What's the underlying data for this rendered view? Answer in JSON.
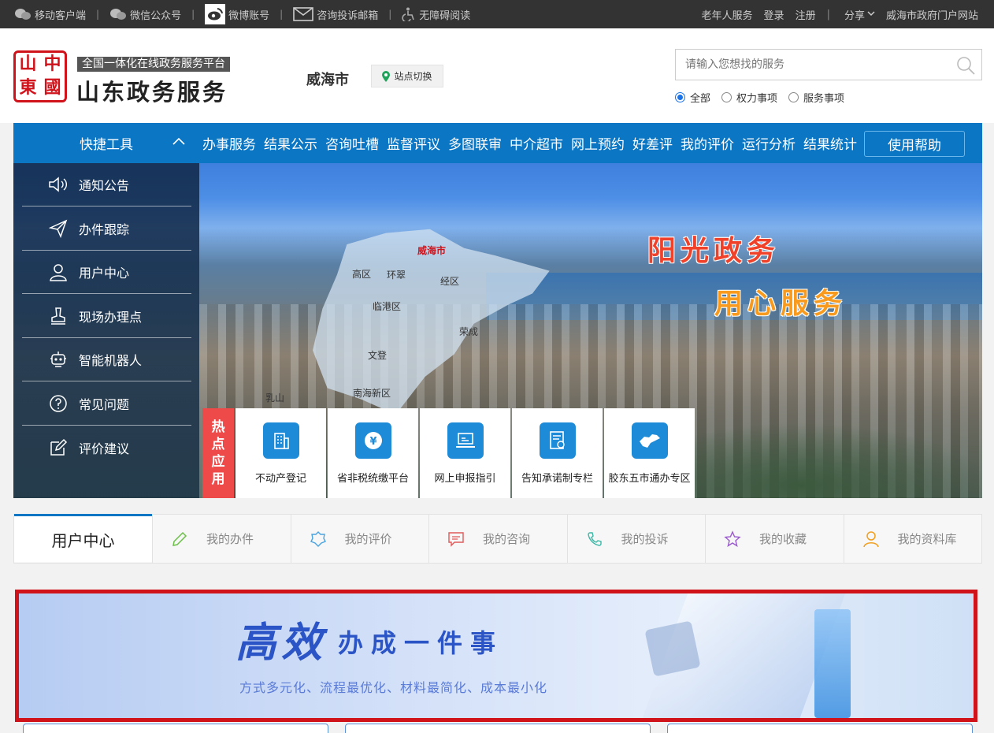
{
  "topbar": {
    "left": [
      {
        "label": "移动客户端",
        "icon": "wechat-like-icon"
      },
      {
        "label": "微信公众号",
        "icon": "wechat-icon"
      },
      {
        "label": "微博账号",
        "icon": "weibo-icon"
      },
      {
        "label": "咨询投诉邮箱",
        "icon": "mail-icon"
      },
      {
        "label": "无障碍阅读",
        "icon": "accessibility-icon"
      }
    ],
    "right": {
      "elderly": "老年人服务",
      "login": "登录",
      "register": "注册",
      "share": "分享",
      "portal": "威海市政府门户网站"
    }
  },
  "header": {
    "seal_chars": [
      "中",
      "國",
      "山",
      "東"
    ],
    "tagline": "全国一体化在线政务服务平台",
    "title": "山东政务服务",
    "city": "威海市",
    "switch_label": "站点切换",
    "search_placeholder": "请输入您想找的服务",
    "radios": [
      {
        "label": "全部",
        "checked": true
      },
      {
        "label": "权力事项",
        "checked": false
      },
      {
        "label": "服务事项",
        "checked": false
      }
    ]
  },
  "nav": {
    "quick_tools": "快捷工具",
    "items": [
      "办事服务",
      "结果公示",
      "咨询吐槽",
      "监督评议",
      "多图联审",
      "中介超市",
      "网上预约",
      "好差评",
      "我的评价",
      "运行分析",
      "结果统计"
    ],
    "help": "使用帮助"
  },
  "sidebar": {
    "items": [
      {
        "label": "通知公告",
        "icon": "speaker-icon"
      },
      {
        "label": "办件跟踪",
        "icon": "paper-plane-icon"
      },
      {
        "label": "用户中心",
        "icon": "user-icon"
      },
      {
        "label": "现场办理点",
        "icon": "stamp-icon"
      },
      {
        "label": "智能机器人",
        "icon": "robot-icon"
      },
      {
        "label": "常见问题",
        "icon": "question-icon"
      },
      {
        "label": "评价建议",
        "icon": "edit-icon"
      }
    ]
  },
  "hero": {
    "map_labels": [
      "威海市",
      "高区",
      "环翠",
      "经区",
      "临港区",
      "荣成",
      "文登",
      "乳山",
      "南海新区"
    ],
    "slogan1": "阳光政务",
    "slogan2": "用心服务",
    "hot_tag": [
      "热",
      "点",
      "应",
      "用"
    ],
    "hot_apps": [
      "不动产登记",
      "省非税统缴平台",
      "网上申报指引",
      "告知承诺制专栏",
      "胶东五市通办专区"
    ]
  },
  "user_center": {
    "title": "用户中心",
    "tabs": [
      {
        "label": "我的办件",
        "icon": "pencil-icon",
        "color": "#6cc04a"
      },
      {
        "label": "我的评价",
        "icon": "badge-icon",
        "color": "#4aa3df"
      },
      {
        "label": "我的咨询",
        "icon": "chat-icon",
        "color": "#e05a5a"
      },
      {
        "label": "我的投诉",
        "icon": "phone-icon",
        "color": "#3cb7a6"
      },
      {
        "label": "我的收藏",
        "icon": "star-icon",
        "color": "#9b59d0"
      },
      {
        "label": "我的资料库",
        "icon": "person-icon",
        "color": "#f0a020"
      }
    ]
  },
  "banner": {
    "big": "高效",
    "mid": "办成一件事",
    "sub": "方式多元化、流程最优化、材料最简化、成本最小化"
  },
  "colors": {
    "brand_blue": "#0b76c4",
    "seal_red": "#d0121b",
    "hot_red": "#ef4a4a"
  }
}
